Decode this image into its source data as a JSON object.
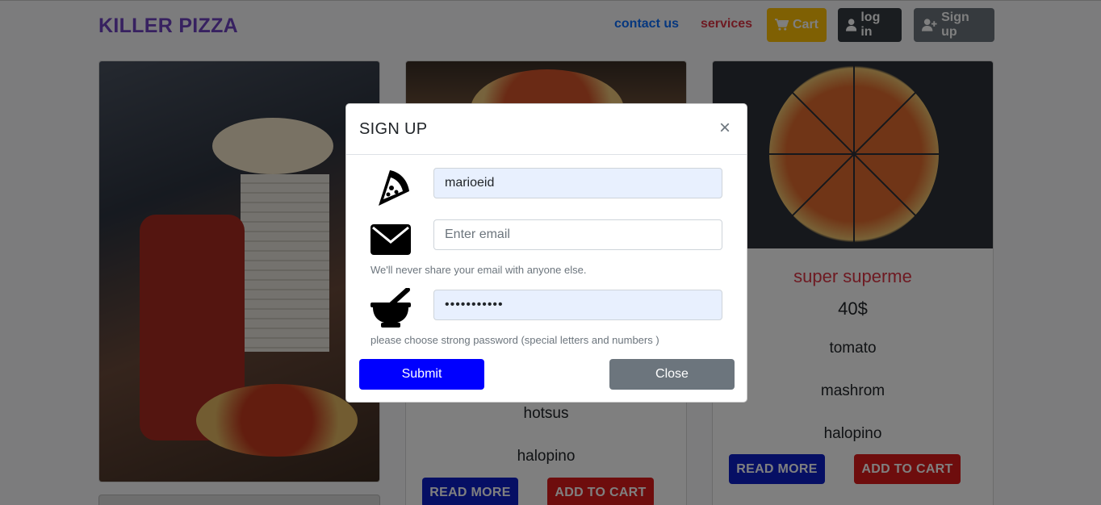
{
  "navbar": {
    "brand": "KILLER PIZZA",
    "contact": "contact us",
    "services": "services",
    "cart": "Cart",
    "login": "log in",
    "signup": "Sign up"
  },
  "cards": [
    {},
    {
      "items": [
        "hotsus",
        "halopino"
      ],
      "read_more": "READ MORE",
      "add_to_cart": "ADD TO CART"
    },
    {
      "title": "super superme",
      "price": "40$",
      "items": [
        "tomato",
        "mashrom",
        "halopino"
      ],
      "read_more": "READ MORE",
      "add_to_cart": "ADD TO CART"
    }
  ],
  "modal": {
    "title": "SIGN UP",
    "close_x": "×",
    "username_value": "marioeid",
    "email_placeholder": "Enter email",
    "email_help": "We'll never share your email with anyone else.",
    "password_value": "•••••••••••",
    "password_help": "please choose strong password (special letters and numbers )",
    "submit": "Submit",
    "close": "Close"
  },
  "colors": {
    "brand": "#6f42c1",
    "submit": "#0000ff",
    "close": "#6c757d",
    "read_more": "#0d1fc8",
    "add_to_cart": "#dc1a1a",
    "title_red": "#dc3545"
  }
}
